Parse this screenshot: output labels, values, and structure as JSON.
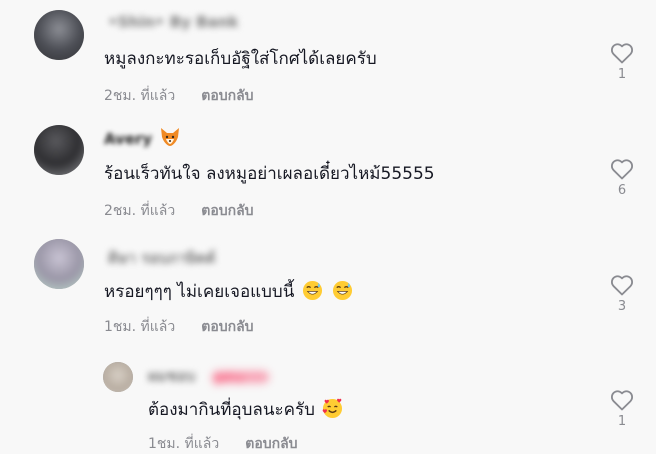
{
  "comments": [
    {
      "username": "•Shin• By Bank",
      "text": "หมูลงกะทะรอเก็บอัฐิใส่โกศได้เลยครับ",
      "time": "2ชม. ที่แล้ว",
      "reply_label": "ตอบกลับ",
      "likes": "1"
    },
    {
      "username": "Avery",
      "username_emoji": "fox-face-emoji",
      "text": "ร้อนเร็วทันใจ ลงหมูอย่าเผลอเดี๋ยวไหม้55555",
      "time": "2ชม. ที่แล้ว",
      "reply_label": "ตอบกลับ",
      "likes": "6"
    },
    {
      "username": "ดิษา รอบภาษิตต์",
      "text": "หรอยๆๆๆ ไม่เคยเจอแบบนี้",
      "text_emojis": [
        "grinning-sweat-emoji",
        "grinning-sweat-emoji"
      ],
      "time": "1ชม. ที่แล้ว",
      "reply_label": "ตอบกลับ",
      "likes": "3"
    },
    {
      "username": "ผมชอบ",
      "username_badge": "ผู้สร้าง",
      "text": "ต้องมากินที่อุบลนะครับ",
      "text_emojis": [
        "smiling-hearts-emoji"
      ],
      "time": "1ชม. ที่แล้ว",
      "reply_label": "ตอบกลับ",
      "likes": "1"
    }
  ],
  "colors": {
    "background": "#f8f8f8",
    "text": "#161823",
    "meta": "#8a8b91",
    "badge": "#fe2c55"
  }
}
